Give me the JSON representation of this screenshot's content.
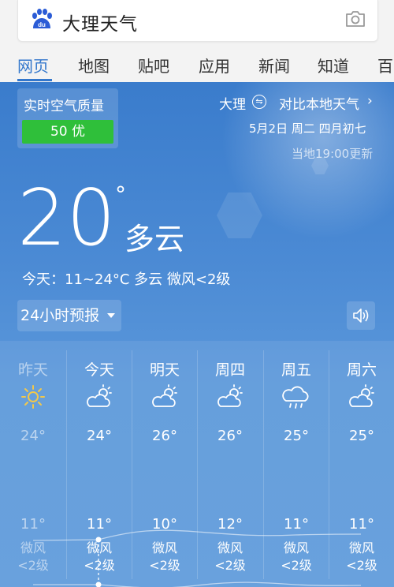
{
  "search": {
    "query": "大理天气"
  },
  "tabs": [
    {
      "label": "网页",
      "active": true
    },
    {
      "label": "地图",
      "active": false
    },
    {
      "label": "贴吧",
      "active": false
    },
    {
      "label": "应用",
      "active": false
    },
    {
      "label": "新闻",
      "active": false
    },
    {
      "label": "知道",
      "active": false
    },
    {
      "label": "百",
      "active": false
    }
  ],
  "weather": {
    "aqi_title": "实时空气质量",
    "aqi_value": "50 优",
    "city": "大理",
    "compare_label": "对比本地天气",
    "date": "5月2日 周二 四月初七",
    "update_time": "当地19:00更新",
    "temperature": "20",
    "degree_symbol": "°",
    "condition": "多云",
    "today_summary": "今天：11~24°C 多云 微风<2级",
    "forecast_button": "24小时预报"
  },
  "forecast": [
    {
      "day": "昨天",
      "icon": "sunny-icon",
      "high": "24°",
      "low": "11°",
      "wind": "微风",
      "wind_level": "<2级",
      "past": true
    },
    {
      "day": "今天",
      "icon": "partly-cloudy-icon",
      "high": "24°",
      "low": "11°",
      "wind": "微风",
      "wind_level": "<2级",
      "past": false
    },
    {
      "day": "明天",
      "icon": "partly-cloudy-icon",
      "high": "26°",
      "low": "10°",
      "wind": "微风",
      "wind_level": "<2级",
      "past": false
    },
    {
      "day": "周四",
      "icon": "partly-cloudy-icon",
      "high": "26°",
      "low": "12°",
      "wind": "微风",
      "wind_level": "<2级",
      "past": false
    },
    {
      "day": "周五",
      "icon": "rain-icon",
      "high": "25°",
      "low": "11°",
      "wind": "微风",
      "wind_level": "<2级",
      "past": false
    },
    {
      "day": "周六",
      "icon": "partly-cloudy-icon",
      "high": "25°",
      "low": "11°",
      "wind": "微风",
      "wind_level": "<2级",
      "past": false
    }
  ],
  "colors": {
    "accent": "#3377cc",
    "aqi_good": "#2fbf3a",
    "card_top": "#3a7ccc",
    "card_bottom": "#5d99db"
  }
}
